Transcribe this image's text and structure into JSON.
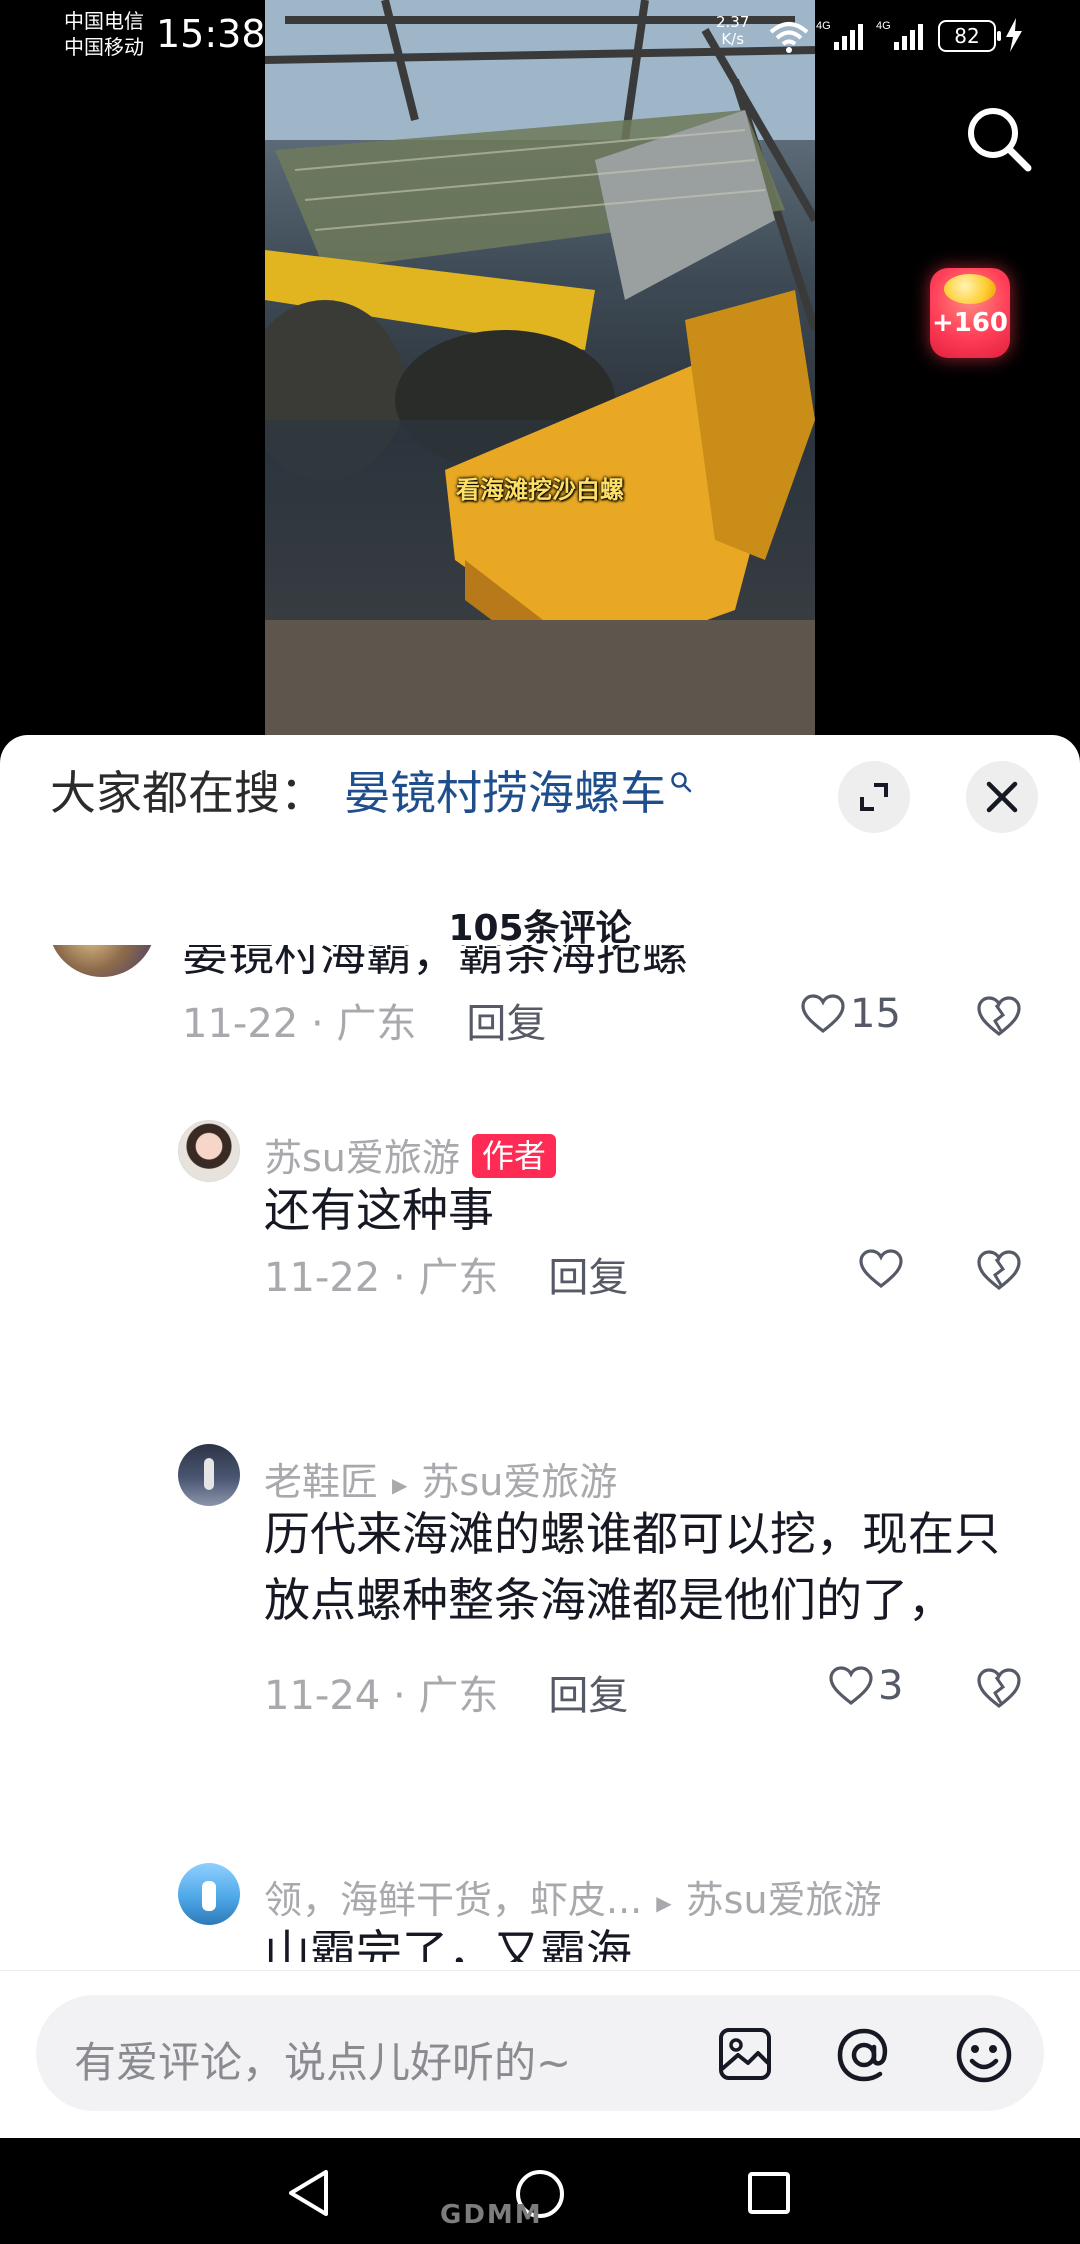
{
  "status_bar": {
    "carrier_1": "中国电信",
    "carrier_2": "中国移动",
    "time": "15:38",
    "net_speed_value": "2.37",
    "net_speed_unit": "K/s",
    "battery": "82"
  },
  "video": {
    "caption": "看海滩挖沙白螺"
  },
  "reward": {
    "label": "+160"
  },
  "sheet": {
    "search_prefix": "大家都在搜：",
    "search_keyword": "晏镜村捞海螺车",
    "comment_count": "105条评论",
    "comments": [
      {
        "text": "晏镜村海霸，霸条海抢螺",
        "date": "11-22",
        "location": "广东",
        "reply": "回复",
        "likes": "15"
      },
      {
        "user": "苏su爱旅游",
        "tag": "作者",
        "text": "还有这种事",
        "date": "11-22",
        "location": "广东",
        "reply": "回复"
      },
      {
        "user": "老鞋匠",
        "reply_to": "苏su爱旅游",
        "text": "历代来海滩的螺谁都可以挖，现在只放点螺种整条海滩都是他们的了，",
        "date": "11-24",
        "location": "广东",
        "reply": "回复",
        "likes": "3"
      },
      {
        "user": "领，海鲜干货，虾皮...",
        "reply_to": "苏su爱旅游",
        "text": "山霸完了，又霸海"
      }
    ]
  },
  "input": {
    "placeholder": "有爱评论，说点儿好听的~"
  },
  "watermark": "GDMM"
}
